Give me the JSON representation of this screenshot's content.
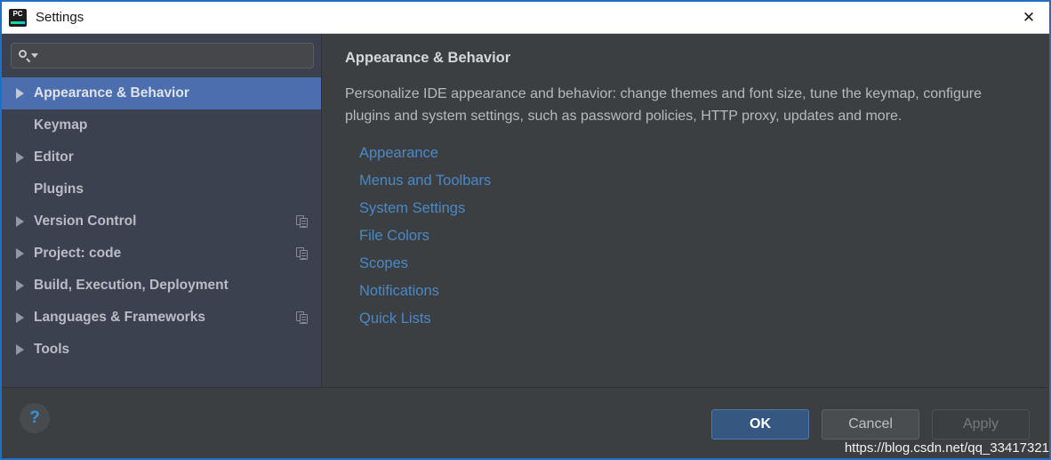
{
  "window": {
    "title": "Settings",
    "app_icon": "pycharm-icon",
    "app_icon_text": "PC",
    "close_label": "✕",
    "border_color": "#1f6fc4"
  },
  "search": {
    "value": "",
    "placeholder": "",
    "icon": "search-icon"
  },
  "sidebar": {
    "background": "#3c4150",
    "selection_color": "#4b6eaf",
    "items": [
      {
        "label": "Appearance & Behavior",
        "expandable": true,
        "selected": true,
        "has_project_icon": false
      },
      {
        "label": "Keymap",
        "expandable": false,
        "selected": false,
        "has_project_icon": false
      },
      {
        "label": "Editor",
        "expandable": true,
        "selected": false,
        "has_project_icon": false
      },
      {
        "label": "Plugins",
        "expandable": false,
        "selected": false,
        "has_project_icon": false
      },
      {
        "label": "Version Control",
        "expandable": true,
        "selected": false,
        "has_project_icon": true
      },
      {
        "label": "Project: code",
        "expandable": true,
        "selected": false,
        "has_project_icon": true
      },
      {
        "label": "Build, Execution, Deployment",
        "expandable": true,
        "selected": false,
        "has_project_icon": false
      },
      {
        "label": "Languages & Frameworks",
        "expandable": true,
        "selected": false,
        "has_project_icon": true
      },
      {
        "label": "Tools",
        "expandable": true,
        "selected": false,
        "has_project_icon": false
      }
    ]
  },
  "panel": {
    "title": "Appearance & Behavior",
    "description": "Personalize IDE appearance and behavior: change themes and font size, tune the keymap, configure plugins and system settings, such as password policies, HTTP proxy, updates and more.",
    "link_color": "#4a88c7",
    "links": [
      {
        "label": "Appearance"
      },
      {
        "label": "Menus and Toolbars"
      },
      {
        "label": "System Settings"
      },
      {
        "label": "File Colors"
      },
      {
        "label": "Scopes"
      },
      {
        "label": "Notifications"
      },
      {
        "label": "Quick Lists"
      }
    ]
  },
  "footer": {
    "help_label": "?",
    "ok_label": "OK",
    "cancel_label": "Cancel",
    "apply_label": "Apply",
    "apply_disabled": true,
    "watermark": "https://blog.csdn.net/qq_33417321"
  }
}
